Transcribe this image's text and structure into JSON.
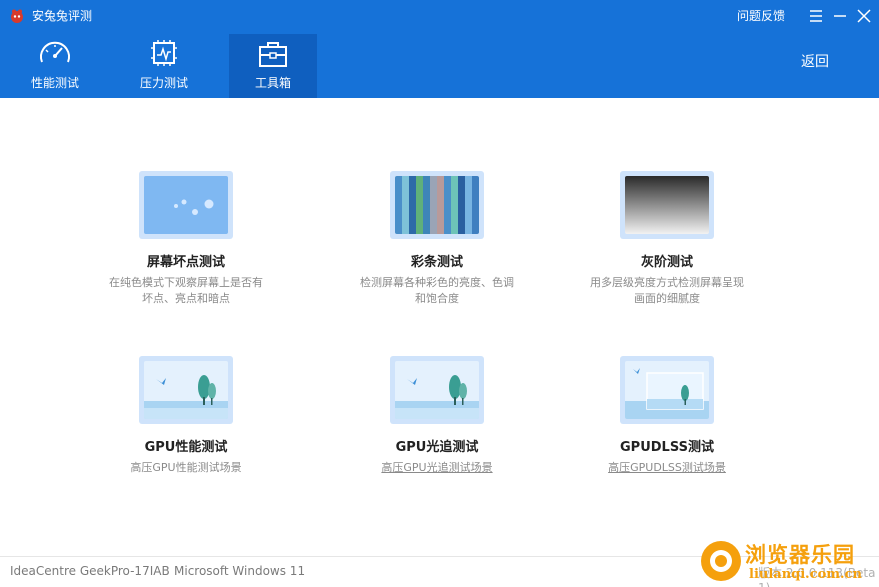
{
  "window": {
    "title": "安兔兔评测",
    "feedback_label": "问题反馈",
    "controls": {
      "menu_icon": "menu-icon",
      "minimize_icon": "minimize-icon",
      "close_icon": "close-icon"
    }
  },
  "nav": {
    "tabs": [
      {
        "label": "性能测试",
        "icon": "speedometer-icon",
        "active": false
      },
      {
        "label": "压力测试",
        "icon": "chip-pulse-icon",
        "active": false
      },
      {
        "label": "工具箱",
        "icon": "toolbox-icon",
        "active": true
      }
    ],
    "back_label": "返回"
  },
  "tools": [
    {
      "title": "屏幕坏点测试",
      "desc_lines": [
        "在纯色模式下观察屏幕上是否有",
        "坏点、亮点和暗点"
      ],
      "thumb": "dead-pixel"
    },
    {
      "title": "彩条测试",
      "desc_lines": [
        "检测屏幕各种彩色的亮度、色调",
        "和饱合度"
      ],
      "thumb": "color-bars"
    },
    {
      "title": "灰阶测试",
      "desc_lines": [
        "用多层级亮度方式检测屏幕呈现",
        "画面的细腻度"
      ],
      "thumb": "grayscale"
    },
    {
      "title": "GPU性能测试",
      "desc_lines": [
        "高压GPU性能测试场景"
      ],
      "thumb": "landscape"
    },
    {
      "title": "GPU光追测试",
      "desc_lines": [
        "高压GPU光追测试场景"
      ],
      "thumb": "landscape"
    },
    {
      "title": "GPUDLSS测试",
      "desc_lines": [
        "高压GPUDLSS测试场景"
      ],
      "thumb": "landscape-compare"
    }
  ],
  "footer": {
    "device": "IdeaCentre GeekPro-17IAB",
    "os": "Microsoft Windows 11",
    "version": "版本 2.0.0.113(Beta 1)"
  },
  "watermark": {
    "text": "浏览器乐园",
    "url": "liulanqi.com.cn"
  },
  "colors": {
    "header": "#1672d8",
    "active_tab": "#0f5fbf",
    "accent_watermark": "#f5a00d"
  }
}
